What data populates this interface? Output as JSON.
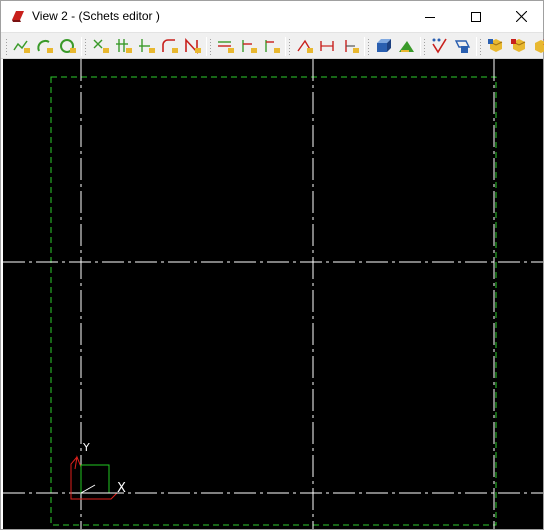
{
  "window": {
    "title": "View 2 - (Schets editor )",
    "controls": [
      "minimize",
      "maximize",
      "close"
    ]
  },
  "toolbar": {
    "groups": [
      [
        "polyline-icon",
        "arc-icon",
        "circle-arc-icon"
      ],
      [
        "point-snap-icon",
        "intersect-icon",
        "trim-icon",
        "fillet-icon",
        "delete-segment-icon"
      ],
      [
        "offset-lines-icon",
        "parallel-icon",
        "perpendicular-icon"
      ],
      [
        "dimension-angle-icon",
        "dimension-horizontal-icon",
        "dimension-vertical-icon"
      ],
      [
        "extrude-icon",
        "revolve-icon"
      ],
      [
        "check-sketch-icon",
        "sketch-plane-icon"
      ],
      [
        "material-add-icon",
        "material-edit-icon",
        "material-remove-icon"
      ]
    ]
  },
  "canvas": {
    "background": "#000000",
    "axis_color": "#ffffff",
    "boundary_color": "#2ecc2e",
    "triad": {
      "x_label": "X",
      "y_label": "Y",
      "x_color": "#ffffff",
      "red_color": "#e0201c",
      "green_color": "#22c822"
    }
  }
}
